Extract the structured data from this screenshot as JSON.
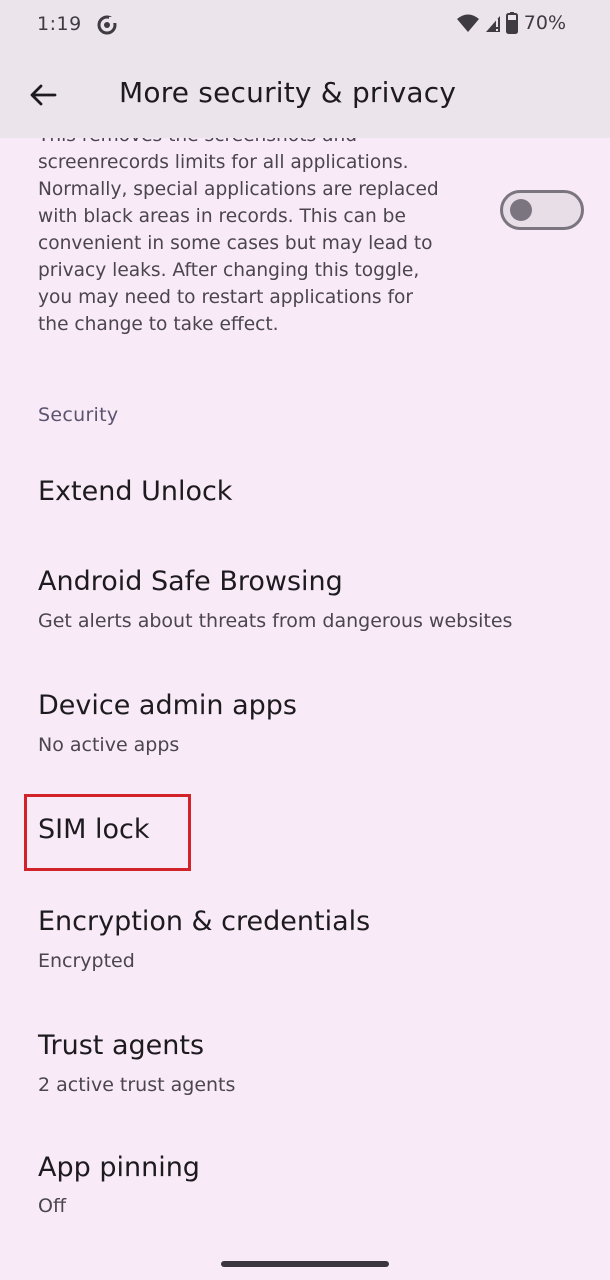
{
  "status_bar": {
    "time": "1:19",
    "app_icon": "app-notification-icon",
    "wifi_icon": "wifi-icon",
    "signal_icon": "cell-signal-icon",
    "battery_icon": "battery-icon",
    "battery_percent": "70%"
  },
  "header": {
    "back_icon": "arrow-back-icon",
    "title": "More security & privacy"
  },
  "screenshot_setting": {
    "description_lines": [
      "This removes the screenshots and",
      "screenrecords limits for all applications.",
      "Normally, special applications are replaced",
      "with black areas in records. This can be",
      "convenient in some cases but may lead to",
      "privacy leaks. After changing this toggle,",
      "you may need to restart applications for",
      "the change to take effect."
    ],
    "toggle_state": "off"
  },
  "security_section": {
    "header": "Security",
    "items": [
      {
        "title": "Extend Unlock",
        "subtitle": ""
      },
      {
        "title": "Android Safe Browsing",
        "subtitle": "Get alerts about threats from dangerous websites"
      },
      {
        "title": "Device admin apps",
        "subtitle": "No active apps"
      },
      {
        "title": "SIM lock",
        "subtitle": ""
      },
      {
        "title": "Encryption & credentials",
        "subtitle": "Encrypted"
      },
      {
        "title": "Trust agents",
        "subtitle": "2 active trust agents"
      },
      {
        "title": "App pinning",
        "subtitle": "Off"
      }
    ]
  },
  "colors": {
    "background": "#f8eaf6",
    "top_bar": "#ebe4ea",
    "highlight_border": "#d2232a"
  }
}
